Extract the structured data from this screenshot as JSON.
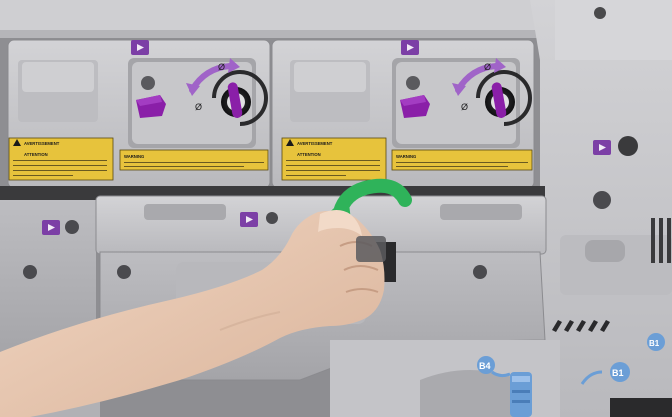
{
  "photo": {
    "subject": "Printer front panel with hand turning a drum unit lever",
    "colors": {
      "panel": "#c9c9cb",
      "panel_shadow": "#9a9a9d",
      "dark_gap": "#3a3a3c",
      "lever_purple": "#8a1fa8",
      "marker_purple": "#7c3fa6",
      "label_yellow": "#e7c33c",
      "arrow_green": "#2fb35a",
      "arrow_light_purple": "#a064c8",
      "skin": "#e8c8b0",
      "connector_blue": "#6b9ed6"
    }
  },
  "labels": {
    "left": {
      "warning_a": "AVERTISSEMENT",
      "warning_b": "ATTENTION",
      "warning_c": "WARNING"
    },
    "right": {
      "warning_a": "AVERTISSEMENT",
      "warning_b": "ATTENTION",
      "warning_c": "WARNING"
    }
  },
  "markers": {
    "lock_symbol": "Ø",
    "unlock_symbol": "Ø",
    "b4": "B4",
    "b1": "B1",
    "b1_alt": "B1"
  }
}
